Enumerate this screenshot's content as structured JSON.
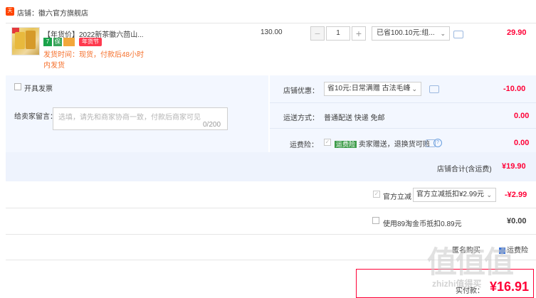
{
  "shop": {
    "icon_text": "天猫",
    "label": "店铺：徽六官方旗舰店"
  },
  "item": {
    "title": "【年货价】2022新茶徽六茴山...",
    "badges": [
      "7",
      "保",
      "",
      "年货节"
    ],
    "ship_line1": "发货时间：现货，付款后48小时",
    "ship_line2": "内发货",
    "unit_price": "130.00",
    "quantity": "1",
    "minus": "−",
    "plus": "+",
    "promo_select": "已省100.10元:组...",
    "total": "29.90"
  },
  "invoice": {
    "label": "开具发票"
  },
  "memo": {
    "label": "给卖家留言：",
    "placeholder": "选填，请先和商家协商一致，付款后商家可见",
    "counter": "0/200"
  },
  "shop_discount": {
    "label": "店铺优惠：",
    "selected": "省10元:日常满赠 古法毛峰",
    "value": "-10.00"
  },
  "delivery": {
    "label": "运送方式：",
    "method": "普通配送 快递 免邮",
    "value": "0.00"
  },
  "insurance": {
    "label": "运费险：",
    "tag": "运费险",
    "text": "卖家赠送，退换货可赔",
    "info": "?",
    "value": "0.00"
  },
  "shop_total": {
    "label": "店铺合计(含运费)",
    "value": "¥19.90"
  },
  "tmall_discount": {
    "label": "官方立减",
    "selected": "官方立减抵扣¥2.99元",
    "value": "-¥2.99"
  },
  "coin": {
    "label": "使用89淘金币抵扣0.89元",
    "value": "¥0.00"
  },
  "extras": {
    "left": "匿名购买",
    "right": "运费险"
  },
  "payment": {
    "label": "实付款：",
    "value": "¥16.91"
  },
  "watermark": {
    "big": "值值值",
    "small": "zhizhi值得买"
  },
  "colors": {
    "accent": "#ff0036",
    "panel": "#eef3fd",
    "orange": "#f5702c"
  }
}
